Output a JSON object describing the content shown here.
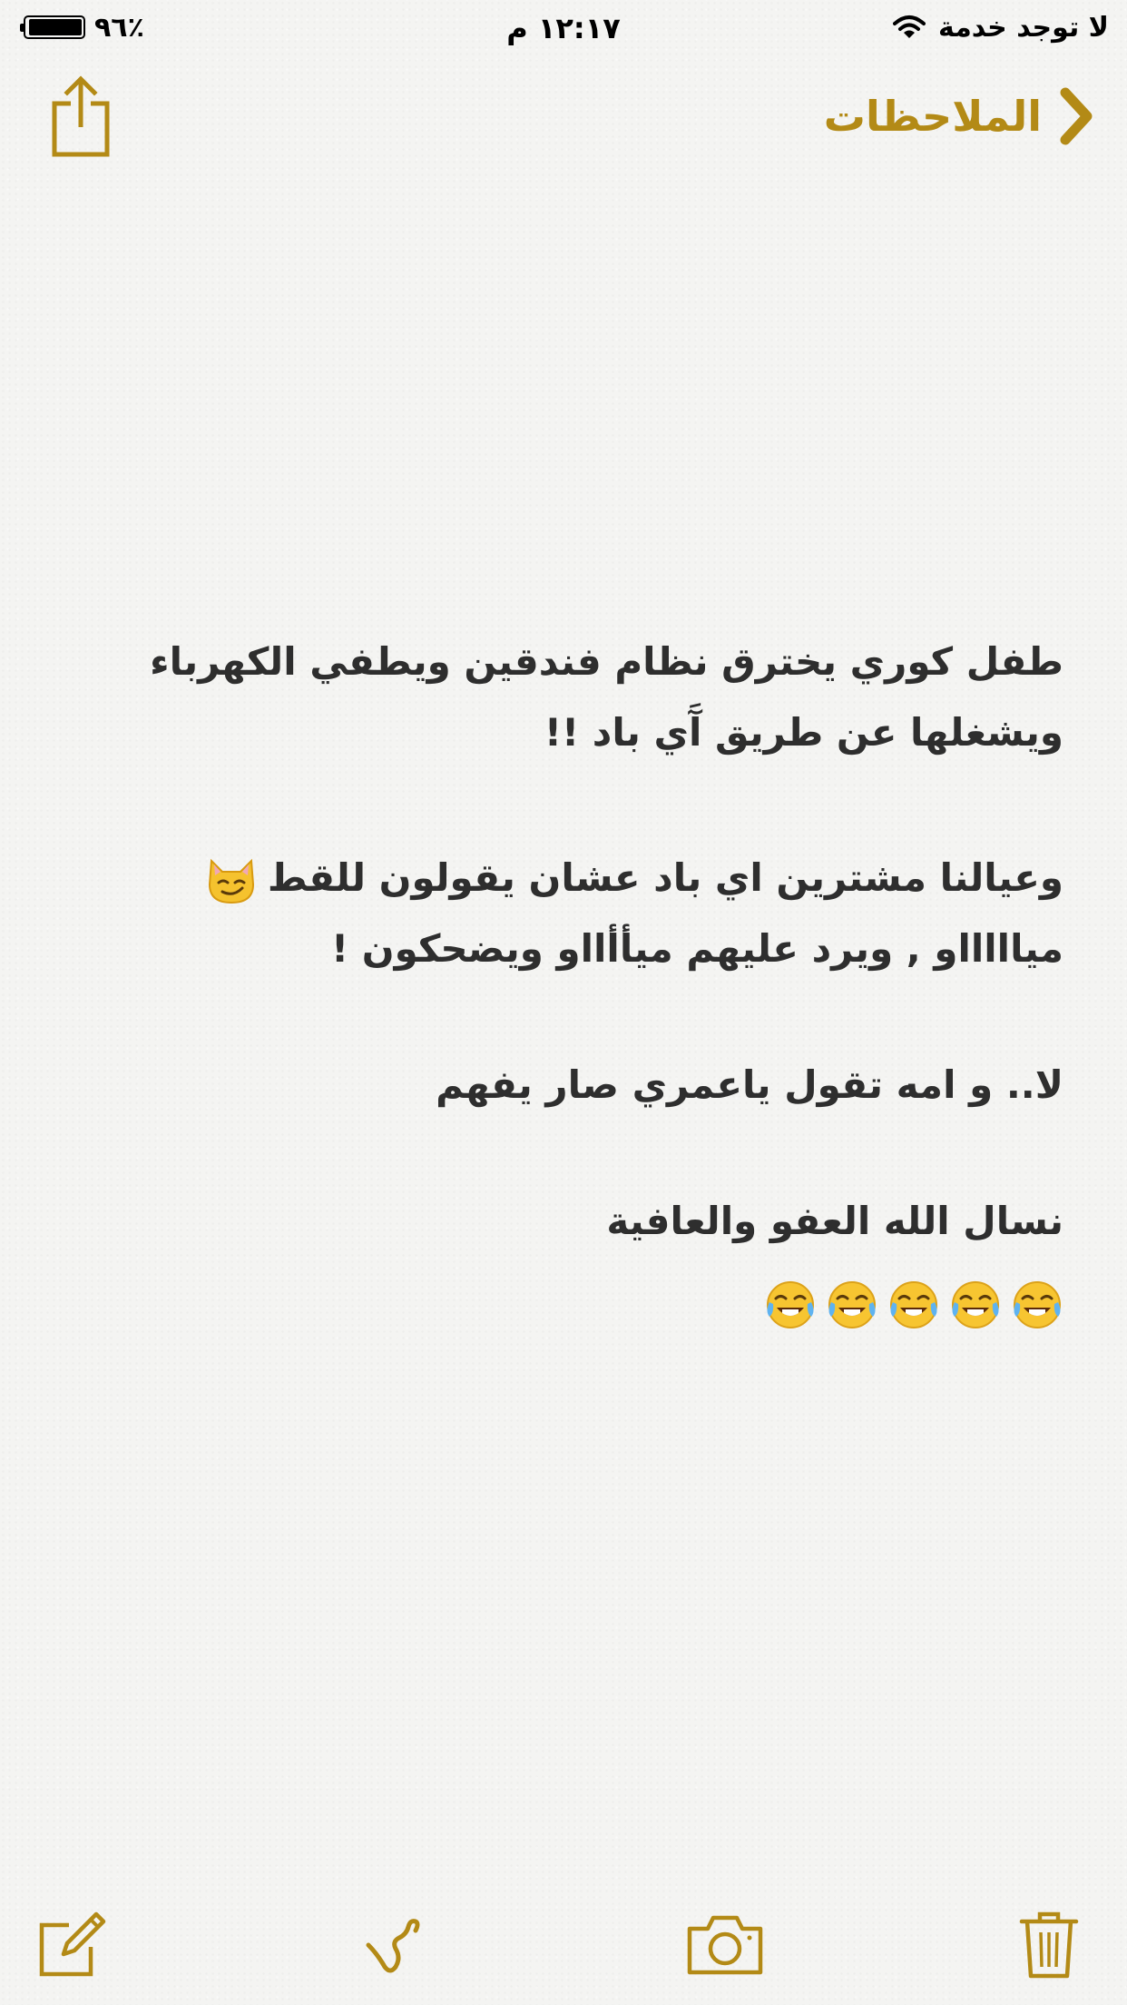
{
  "status_bar": {
    "battery_percent": "٩٦٪",
    "battery_level": 0.96,
    "time": "١٢:١٧ م",
    "carrier": "لا توجد خدمة"
  },
  "nav": {
    "back_label": "الملاحظات"
  },
  "note": {
    "lines": [
      "طفل كوري يخترق نظام فندقين ويطفي الكهرباء",
      "ويشغلها عن طريق آَي باد !!",
      "وعيالنا مشترين اي باد عشان يقولون للقط",
      "مياااااو  , ويرد عليهم ميأأااو ويضحكون !",
      "لا.. و امه تقول ياعمري صار يفهم",
      "نسال الله العفو والعافية"
    ],
    "laugh_emoji_count": 5
  },
  "toolbar": {
    "icons": [
      "compose-icon",
      "sketch-icon",
      "camera-icon",
      "trash-icon"
    ]
  },
  "colors": {
    "accent": "#b38a16",
    "text": "#2e2e2e",
    "background": "#f4f4f2"
  }
}
